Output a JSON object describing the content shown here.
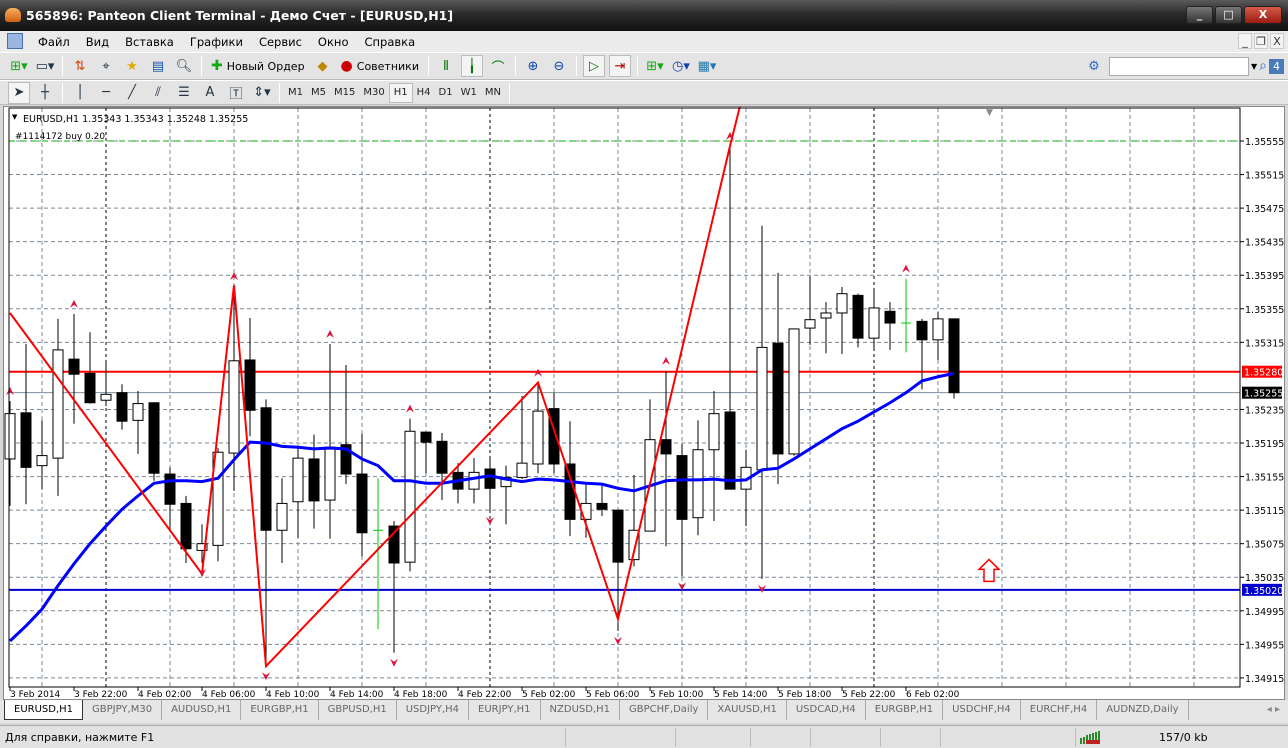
{
  "window": {
    "title": "565896: Panteon Client Terminal - Демо Счет - [EURUSD,H1]",
    "min": "_",
    "max": "□",
    "close": "X"
  },
  "menu": [
    "Файл",
    "Вид",
    "Вставка",
    "Графики",
    "Сервис",
    "Окно",
    "Справка"
  ],
  "mdi": {
    "min": "_",
    "restore": "❐",
    "close": "X"
  },
  "toolbar": {
    "new_order": "Новый Ордер",
    "experts": "Советники",
    "timeframes": [
      "M1",
      "M5",
      "M15",
      "M30",
      "H1",
      "H4",
      "D1",
      "W1",
      "MN"
    ],
    "active_tf": "H1",
    "draw_text": "A",
    "search_placeholder": "",
    "community_badge": "4"
  },
  "chart": {
    "symbol_line": "EURUSD,H1  1.35343 1.35343 1.35248 1.35255",
    "order_label": "#1114172 buy 0.20",
    "price_labels": [
      "1.35555",
      "1.35515",
      "1.35475",
      "1.35435",
      "1.35395",
      "1.35355",
      "1.35315",
      "1.35235",
      "1.35195",
      "1.35155",
      "1.35115",
      "1.35075",
      "1.35035",
      "1.34995",
      "1.34955",
      "1.34915"
    ],
    "time_labels": [
      "3 Feb 2014",
      "3 Feb 22:00",
      "4 Feb 02:00",
      "4 Feb 06:00",
      "4 Feb 10:00",
      "4 Feb 14:00",
      "4 Feb 18:00",
      "4 Feb 22:00",
      "5 Feb 02:00",
      "5 Feb 06:00",
      "5 Feb 10:00",
      "5 Feb 14:00",
      "5 Feb 18:00",
      "5 Feb 22:00",
      "6 Feb 02:00"
    ],
    "levels": {
      "resistance": "1.35280",
      "bid": "1.35255",
      "support": "1.35020"
    },
    "colors": {
      "resistance": "#ff0000",
      "support": "#0000cc",
      "ma": "#0000ff",
      "zigzag": "#ff0000",
      "fractal": "#dc143c",
      "doji": "#00cc00",
      "order": "#00b000"
    }
  },
  "chart_data": {
    "type": "candlestick",
    "ylim": [
      1.34905,
      1.35585
    ],
    "ohlc": [
      [
        1.35176,
        1.35245,
        1.3512,
        1.3523
      ],
      [
        1.35231,
        1.35313,
        1.35122,
        1.35166
      ],
      [
        1.35168,
        1.35222,
        1.3514,
        1.3518
      ],
      [
        1.35177,
        1.35343,
        1.35132,
        1.35306
      ],
      [
        1.35295,
        1.35349,
        1.35218,
        1.35277
      ],
      [
        1.35278,
        1.35327,
        1.35242,
        1.35243
      ],
      [
        1.35246,
        1.35292,
        1.35239,
        1.35253
      ],
      [
        1.35255,
        1.35265,
        1.35211,
        1.35221
      ],
      [
        1.35222,
        1.35257,
        1.35182,
        1.35242
      ],
      [
        1.35243,
        1.35243,
        1.3515,
        1.35159
      ],
      [
        1.35158,
        1.35166,
        1.3509,
        1.35122
      ],
      [
        1.35123,
        1.35132,
        1.35052,
        1.35069
      ],
      [
        1.35067,
        1.35098,
        1.35052,
        1.35075
      ],
      [
        1.35073,
        1.35189,
        1.35054,
        1.35184
      ],
      [
        1.35183,
        1.35382,
        1.35138,
        1.35293
      ],
      [
        1.35294,
        1.35344,
        1.35203,
        1.35234
      ],
      [
        1.35237,
        1.35247,
        1.34929,
        1.35091
      ],
      [
        1.35091,
        1.35153,
        1.35052,
        1.35123
      ],
      [
        1.35125,
        1.35189,
        1.35082,
        1.35177
      ],
      [
        1.35176,
        1.35205,
        1.35093,
        1.35126
      ],
      [
        1.35127,
        1.35313,
        1.35081,
        1.3519
      ],
      [
        1.35193,
        1.35288,
        1.35146,
        1.35158
      ],
      [
        1.35158,
        1.35206,
        1.3506,
        1.35088
      ],
      [
        1.35091,
        1.35153,
        1.34973,
        1.35091
      ],
      [
        1.35096,
        1.35102,
        1.34945,
        1.35052
      ],
      [
        1.35053,
        1.35224,
        1.35042,
        1.35209
      ],
      [
        1.35208,
        1.35208,
        1.35159,
        1.35196
      ],
      [
        1.35197,
        1.35207,
        1.35127,
        1.35159
      ],
      [
        1.3516,
        1.35171,
        1.35123,
        1.3514
      ],
      [
        1.3514,
        1.35177,
        1.35123,
        1.3516
      ],
      [
        1.35164,
        1.35178,
        1.35114,
        1.35141
      ],
      [
        1.35143,
        1.35168,
        1.35098,
        1.35154
      ],
      [
        1.35154,
        1.35251,
        1.35152,
        1.35171
      ],
      [
        1.3517,
        1.35267,
        1.35159,
        1.35233
      ],
      [
        1.35236,
        1.35255,
        1.35159,
        1.3517
      ],
      [
        1.3517,
        1.35221,
        1.35084,
        1.35104
      ],
      [
        1.35104,
        1.35146,
        1.35082,
        1.35123
      ],
      [
        1.35123,
        1.35147,
        1.35108,
        1.35116
      ],
      [
        1.35115,
        1.35115,
        1.34971,
        1.35053
      ],
      [
        1.35056,
        1.35157,
        1.35048,
        1.35091
      ],
      [
        1.3509,
        1.35247,
        1.3509,
        1.35199
      ],
      [
        1.35199,
        1.35281,
        1.35072,
        1.35182
      ],
      [
        1.3518,
        1.35194,
        1.35036,
        1.35104
      ],
      [
        1.35106,
        1.35222,
        1.35085,
        1.35187
      ],
      [
        1.35187,
        1.35257,
        1.35102,
        1.3523
      ],
      [
        1.35232,
        1.35549,
        1.3514,
        1.3514
      ],
      [
        1.3514,
        1.35187,
        1.35096,
        1.35166
      ],
      [
        1.35163,
        1.35454,
        1.35033,
        1.35309
      ],
      [
        1.35314,
        1.35398,
        1.35146,
        1.35182
      ],
      [
        1.35182,
        1.35331,
        1.3518,
        1.35331
      ],
      [
        1.35332,
        1.35394,
        1.35312,
        1.35342
      ],
      [
        1.35344,
        1.35363,
        1.35302,
        1.3535
      ],
      [
        1.3535,
        1.35381,
        1.35301,
        1.35373
      ],
      [
        1.35371,
        1.35373,
        1.35309,
        1.3532
      ],
      [
        1.3532,
        1.35377,
        1.35306,
        1.35356
      ],
      [
        1.35352,
        1.35363,
        1.35306,
        1.35338
      ],
      [
        1.35338,
        1.35391,
        1.35303,
        1.35338
      ],
      [
        1.3534,
        1.35343,
        1.35259,
        1.35318
      ],
      [
        1.35318,
        1.35351,
        1.35294,
        1.35343
      ],
      [
        1.35343,
        1.35343,
        1.35248,
        1.35255
      ]
    ],
    "ma": [
      1.34959,
      1.34977,
      1.34997,
      1.35025,
      1.35051,
      1.35075,
      1.35096,
      1.35116,
      1.35132,
      1.35147,
      1.3515,
      1.3515,
      1.35149,
      1.35153,
      1.35175,
      1.35196,
      1.35195,
      1.35191,
      1.3519,
      1.35188,
      1.35189,
      1.35188,
      1.35176,
      1.35168,
      1.3515,
      1.3515,
      1.35147,
      1.35147,
      1.3515,
      1.35153,
      1.35156,
      1.35152,
      1.35149,
      1.35152,
      1.35151,
      1.35149,
      1.35147,
      1.35146,
      1.35141,
      1.35138,
      1.35144,
      1.3515,
      1.35151,
      1.35151,
      1.35152,
      1.3515,
      1.35151,
      1.35163,
      1.35165,
      1.35176,
      1.35188,
      1.352,
      1.35212,
      1.35221,
      1.35232,
      1.35243,
      1.35255,
      1.35269,
      1.35274,
      1.35278
    ],
    "zigzag": [
      [
        0,
        1.3535
      ],
      [
        12,
        1.35039
      ],
      [
        14,
        1.35383
      ],
      [
        16,
        1.34929
      ],
      [
        33,
        1.35267
      ],
      [
        38,
        1.34985
      ],
      [
        45,
        1.35549
      ]
    ],
    "fractals_up": [
      0,
      4,
      14,
      20,
      25,
      33,
      41,
      45,
      56
    ],
    "fractals_down": [
      12,
      16,
      24,
      30,
      38,
      42,
      47
    ],
    "order_price": 1.35555,
    "arrow_object": {
      "bar": 61,
      "price": 1.3503
    }
  },
  "tabs": [
    "EURUSD,H1",
    "GBPJPY,M30",
    "AUDUSD,H1",
    "EURGBP,H1",
    "GBPUSD,H1",
    "USDJPY,H4",
    "EURJPY,H1",
    "NZDUSD,H1",
    "GBPCHF,Daily",
    "XAUUSD,H1",
    "USDCAD,H4",
    "EURGBP,H1",
    "USDCHF,H4",
    "EURCHF,H4",
    "AUDNZD,Daily"
  ],
  "tab_nav": "◂ ▸",
  "status": {
    "help": "Для справки, нажмите F1",
    "traffic": "157/0 kb"
  }
}
